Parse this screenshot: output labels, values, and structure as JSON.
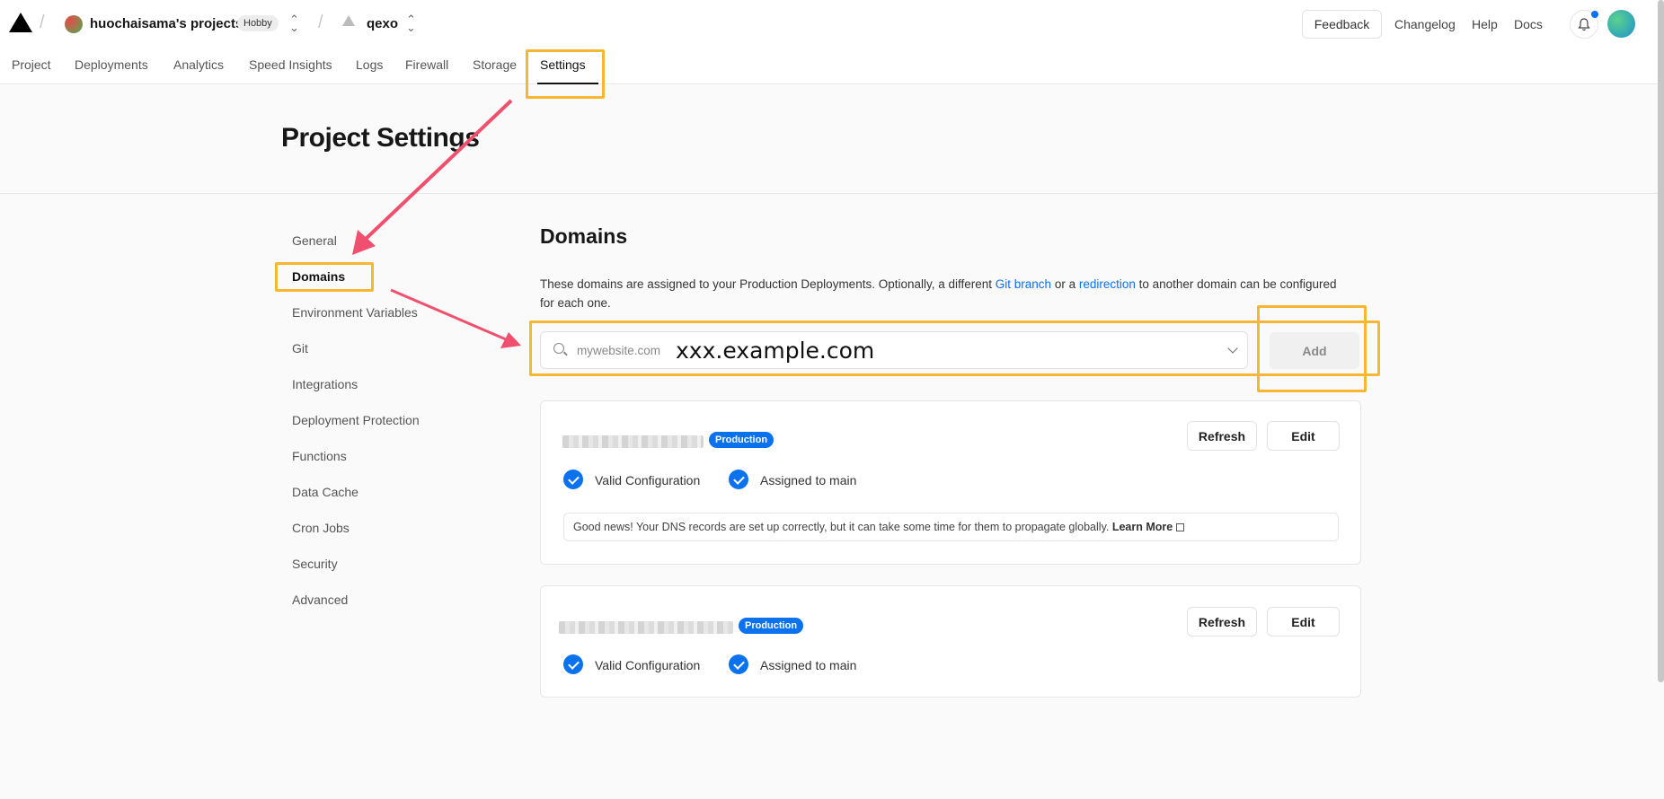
{
  "header": {
    "team_name": "huochaisama's projects",
    "plan_badge": "Hobby",
    "project_name": "qexo",
    "feedback_label": "Feedback",
    "links": [
      "Changelog",
      "Help",
      "Docs"
    ]
  },
  "tabs": [
    "Project",
    "Deployments",
    "Analytics",
    "Speed Insights",
    "Logs",
    "Firewall",
    "Storage",
    "Settings"
  ],
  "active_tab": "Settings",
  "page": {
    "title": "Project Settings"
  },
  "sidebar": {
    "items": [
      "General",
      "Domains",
      "Environment Variables",
      "Git",
      "Integrations",
      "Deployment Protection",
      "Functions",
      "Data Cache",
      "Cron Jobs",
      "Security",
      "Advanced"
    ],
    "active": "Domains"
  },
  "domains": {
    "title": "Domains",
    "desc_1": "These domains are assigned to your Production Deployments. Optionally, a different ",
    "desc_link_1": "Git branch",
    "desc_2": " or a ",
    "desc_link_2": "redirection",
    "desc_3": " to another domain can be configured for each one.",
    "input_placeholder": "mywebsite.com",
    "input_value": "xxx.example.com",
    "add_label": "Add",
    "cards": [
      {
        "badge": "Production",
        "refresh_label": "Refresh",
        "edit_label": "Edit",
        "valid_label": "Valid Configuration",
        "assigned_label": "Assigned to main",
        "note_text": "Good news! Your DNS records are set up correctly, but it can take some time for them to propagate globally. ",
        "note_link": "Learn More"
      },
      {
        "badge": "Production",
        "refresh_label": "Refresh",
        "edit_label": "Edit",
        "valid_label": "Valid Configuration",
        "assigned_label": "Assigned to main"
      }
    ]
  },
  "colors": {
    "accent": "#0a72ef",
    "highlight": "#f7b733",
    "arrow": "#f0506e"
  }
}
